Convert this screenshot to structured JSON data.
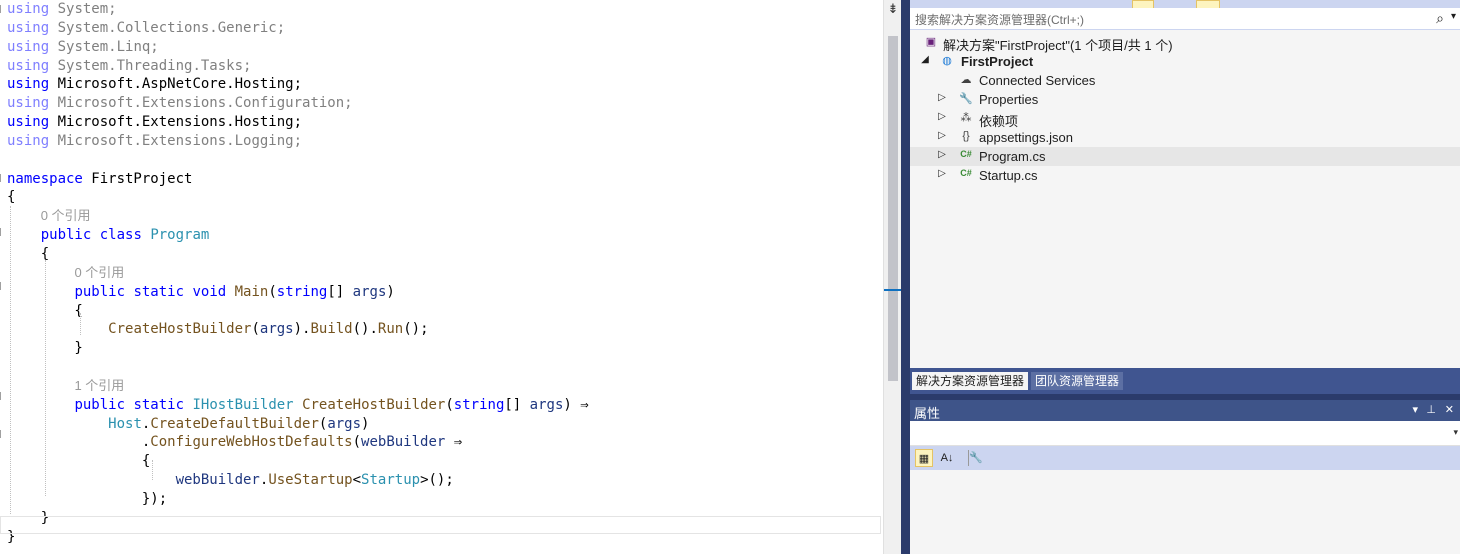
{
  "editor": {
    "lines": [
      {
        "segments": [
          {
            "t": "using",
            "c": "kwg"
          },
          {
            "t": " System;",
            "c": "dim"
          }
        ]
      },
      {
        "segments": [
          {
            "t": "using",
            "c": "kwg"
          },
          {
            "t": " System.Collections.Generic;",
            "c": "dim"
          }
        ]
      },
      {
        "segments": [
          {
            "t": "using",
            "c": "kwg"
          },
          {
            "t": " System.Linq;",
            "c": "dim"
          }
        ]
      },
      {
        "segments": [
          {
            "t": "using",
            "c": "kwg"
          },
          {
            "t": " System.Threading.Tasks;",
            "c": "dim"
          }
        ]
      },
      {
        "segments": [
          {
            "t": "using",
            "c": "kw"
          },
          {
            "t": " Microsoft.AspNetCore.Hosting;",
            "c": ""
          }
        ]
      },
      {
        "segments": [
          {
            "t": "using",
            "c": "kwg"
          },
          {
            "t": " Microsoft.Extensions.Configuration;",
            "c": "dim"
          }
        ]
      },
      {
        "segments": [
          {
            "t": "using",
            "c": "kw"
          },
          {
            "t": " Microsoft.Extensions.Hosting;",
            "c": ""
          }
        ]
      },
      {
        "segments": [
          {
            "t": "using",
            "c": "kwg"
          },
          {
            "t": " Microsoft.Extensions.Logging;",
            "c": "dim"
          }
        ]
      },
      {
        "segments": []
      },
      {
        "segments": [
          {
            "t": "namespace",
            "c": "kw"
          },
          {
            "t": " FirstProject",
            "c": ""
          }
        ]
      },
      {
        "segments": [
          {
            "t": "{",
            "c": ""
          }
        ]
      },
      {
        "lens": "0 个引用",
        "indent": "    "
      },
      {
        "segments": [
          {
            "t": "    ",
            "c": ""
          },
          {
            "t": "public",
            "c": "kw"
          },
          {
            "t": " ",
            "c": ""
          },
          {
            "t": "class",
            "c": "kw"
          },
          {
            "t": " ",
            "c": ""
          },
          {
            "t": "Program",
            "c": "ty"
          }
        ]
      },
      {
        "segments": [
          {
            "t": "    {",
            "c": ""
          }
        ]
      },
      {
        "lens": "0 个引用",
        "indent": "        "
      },
      {
        "segments": [
          {
            "t": "        ",
            "c": ""
          },
          {
            "t": "public",
            "c": "kw"
          },
          {
            "t": " ",
            "c": ""
          },
          {
            "t": "static",
            "c": "kw"
          },
          {
            "t": " ",
            "c": ""
          },
          {
            "t": "void",
            "c": "kw"
          },
          {
            "t": " ",
            "c": ""
          },
          {
            "t": "Main",
            "c": "fn"
          },
          {
            "t": "(",
            "c": ""
          },
          {
            "t": "string",
            "c": "kw"
          },
          {
            "t": "[] ",
            "c": ""
          },
          {
            "t": "args",
            "c": "id"
          },
          {
            "t": ")",
            "c": ""
          }
        ]
      },
      {
        "segments": [
          {
            "t": "        {",
            "c": ""
          }
        ]
      },
      {
        "segments": [
          {
            "t": "            ",
            "c": ""
          },
          {
            "t": "CreateHostBuilder",
            "c": "fn"
          },
          {
            "t": "(",
            "c": ""
          },
          {
            "t": "args",
            "c": "id"
          },
          {
            "t": ").",
            "c": ""
          },
          {
            "t": "Build",
            "c": "fn"
          },
          {
            "t": "().",
            "c": ""
          },
          {
            "t": "Run",
            "c": "fn"
          },
          {
            "t": "();",
            "c": ""
          }
        ]
      },
      {
        "segments": [
          {
            "t": "        }",
            "c": ""
          }
        ]
      },
      {
        "segments": []
      },
      {
        "lens": "1 个引用",
        "indent": "        "
      },
      {
        "segments": [
          {
            "t": "        ",
            "c": ""
          },
          {
            "t": "public",
            "c": "kw"
          },
          {
            "t": " ",
            "c": ""
          },
          {
            "t": "static",
            "c": "kw"
          },
          {
            "t": " ",
            "c": ""
          },
          {
            "t": "IHostBuilder",
            "c": "ty"
          },
          {
            "t": " ",
            "c": ""
          },
          {
            "t": "CreateHostBuilder",
            "c": "fn"
          },
          {
            "t": "(",
            "c": ""
          },
          {
            "t": "string",
            "c": "kw"
          },
          {
            "t": "[] ",
            "c": ""
          },
          {
            "t": "args",
            "c": "id"
          },
          {
            "t": ") ⇒",
            "c": ""
          }
        ]
      },
      {
        "segments": [
          {
            "t": "            ",
            "c": ""
          },
          {
            "t": "Host",
            "c": "ty"
          },
          {
            "t": ".",
            "c": ""
          },
          {
            "t": "CreateDefaultBuilder",
            "c": "fn"
          },
          {
            "t": "(",
            "c": ""
          },
          {
            "t": "args",
            "c": "id"
          },
          {
            "t": ")",
            "c": ""
          }
        ]
      },
      {
        "segments": [
          {
            "t": "                .",
            "c": ""
          },
          {
            "t": "ConfigureWebHostDefaults",
            "c": "fn"
          },
          {
            "t": "(",
            "c": ""
          },
          {
            "t": "webBuilder",
            "c": "id"
          },
          {
            "t": " ⇒",
            "c": ""
          }
        ]
      },
      {
        "segments": [
          {
            "t": "                {",
            "c": ""
          }
        ]
      },
      {
        "segments": [
          {
            "t": "                    ",
            "c": ""
          },
          {
            "t": "webBuilder",
            "c": "id"
          },
          {
            "t": ".",
            "c": ""
          },
          {
            "t": "UseStartup",
            "c": "fn"
          },
          {
            "t": "<",
            "c": ""
          },
          {
            "t": "Startup",
            "c": "ty"
          },
          {
            "t": ">();",
            "c": ""
          }
        ]
      },
      {
        "segments": [
          {
            "t": "                });",
            "c": ""
          }
        ]
      },
      {
        "segments": [
          {
            "t": "    }",
            "c": ""
          }
        ]
      },
      {
        "segments": [
          {
            "t": "}",
            "c": ""
          }
        ]
      }
    ]
  },
  "scroll": {
    "split_glyph": "⇟"
  },
  "solution_explorer": {
    "search_placeholder": "搜索解决方案资源管理器(Ctrl+;)",
    "search_icon": "⌕",
    "search_dropdown": "▾",
    "items": [
      {
        "label": "解决方案\"FirstProject\"(1 个项目/共 1 个)",
        "icon": "solution-icon",
        "glyph": "▣",
        "color": "#68217a",
        "arrow": "",
        "bold": false
      },
      {
        "label": "FirstProject",
        "icon": "web-project-icon",
        "glyph": "◍",
        "color": "#1e7bd6",
        "arrow": "◢",
        "bold": true
      },
      {
        "label": "Connected Services",
        "icon": "connected-services-icon",
        "glyph": "☁",
        "color": "#424242",
        "arrow": "",
        "bold": false
      },
      {
        "label": "Properties",
        "icon": "properties-icon",
        "glyph": "🔧",
        "color": "#a0790c",
        "arrow": "▷",
        "bold": false
      },
      {
        "label": "依赖项",
        "icon": "dependencies-icon",
        "glyph": "⁂",
        "color": "#424242",
        "arrow": "▷",
        "bold": false
      },
      {
        "label": "appsettings.json",
        "icon": "json-file-icon",
        "glyph": "{}",
        "color": "#424242",
        "arrow": "▷",
        "bold": false
      },
      {
        "label": "Program.cs",
        "icon": "csharp-file-icon",
        "glyph": "C#",
        "color": "#388a34",
        "arrow": "▷",
        "bold": false
      },
      {
        "label": "Startup.cs",
        "icon": "csharp-file-icon",
        "glyph": "C#",
        "color": "#388a34",
        "arrow": "▷",
        "bold": false
      }
    ],
    "selected_index": 6,
    "tabs": [
      {
        "label": "解决方案资源管理器",
        "active": true
      },
      {
        "label": "团队资源管理器",
        "active": false
      }
    ]
  },
  "properties": {
    "title": "属性",
    "title_buttons": [
      "▾",
      "⊥",
      "✕"
    ],
    "combo_arrow": "▾",
    "toolbar": [
      {
        "name": "categorized-button",
        "glyph": "▦",
        "active": true
      },
      {
        "name": "alphabetical-button",
        "glyph": "A↓",
        "active": false
      },
      {
        "name": "property-pages-button",
        "glyph": "🔧",
        "active": false
      }
    ]
  },
  "colors": {
    "keyword": "#0000ff",
    "type": "#2b91af",
    "identifier": "#1f377f",
    "method": "#74531f",
    "vs_dark_blue": "#2b3b6b"
  }
}
